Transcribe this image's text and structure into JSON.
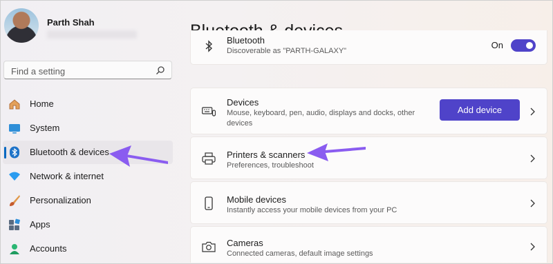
{
  "user": {
    "name": "Parth Shah"
  },
  "search": {
    "placeholder": "Find a setting"
  },
  "sidebar": {
    "items": [
      {
        "label": "Home",
        "icon": "home-icon"
      },
      {
        "label": "System",
        "icon": "system-icon"
      },
      {
        "label": "Bluetooth & devices",
        "icon": "bluetooth-icon",
        "active": true
      },
      {
        "label": "Network & internet",
        "icon": "wifi-icon"
      },
      {
        "label": "Personalization",
        "icon": "brush-icon"
      },
      {
        "label": "Apps",
        "icon": "apps-icon"
      },
      {
        "label": "Accounts",
        "icon": "account-icon"
      }
    ]
  },
  "page": {
    "title": "Bluetooth & devices"
  },
  "bluetooth_card": {
    "title": "Bluetooth",
    "subtitle": "Discoverable as \"PARTH-GALAXY\"",
    "toggle_label": "On",
    "toggle_on": true
  },
  "devices_card": {
    "title": "Devices",
    "subtitle": "Mouse, keyboard, pen, audio, displays and docks, other devices",
    "button": "Add device"
  },
  "printers_card": {
    "title": "Printers & scanners",
    "subtitle": "Preferences, troubleshoot"
  },
  "mobile_card": {
    "title": "Mobile devices",
    "subtitle": "Instantly access your mobile devices from your PC"
  },
  "cameras_card": {
    "title": "Cameras",
    "subtitle": "Connected cameras, default image settings"
  },
  "colors": {
    "accent": "#4f43c9",
    "annotation_arrow": "#8a5cf0",
    "nav_indicator": "#0067c0"
  }
}
